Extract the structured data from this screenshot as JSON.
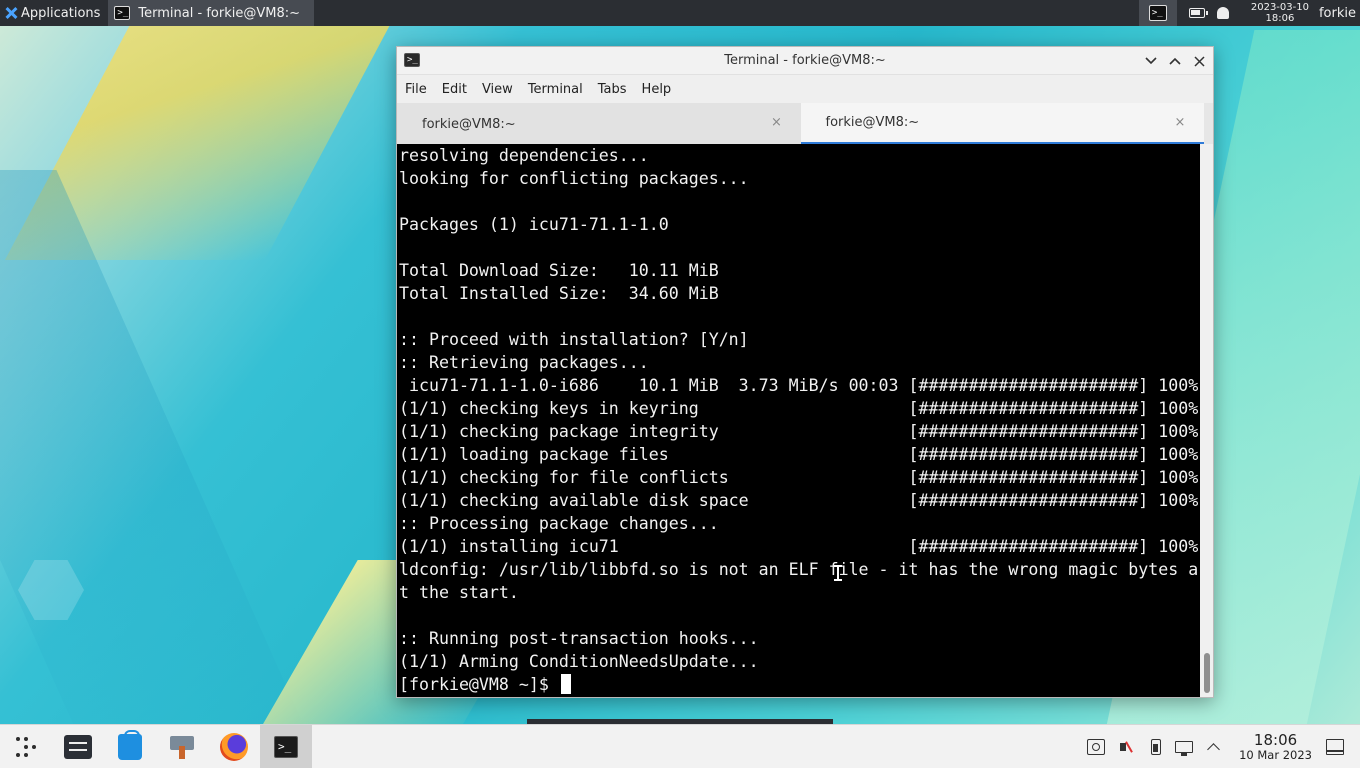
{
  "top_panel": {
    "applications_label": "Applications",
    "task_title": "Terminal - forkie@VM8:~",
    "date": "2023-03-10",
    "time": "18:06",
    "user": "forkie"
  },
  "window": {
    "title": "Terminal - forkie@VM8:~",
    "menu": [
      "File",
      "Edit",
      "View",
      "Terminal",
      "Tabs",
      "Help"
    ],
    "tabs": [
      {
        "label": "forkie@VM8:~",
        "active": false
      },
      {
        "label": "forkie@VM8:~",
        "active": true
      }
    ]
  },
  "terminal": {
    "lines": [
      "resolving dependencies...",
      "looking for conflicting packages...",
      "",
      "Packages (1) icu71-71.1-1.0",
      "",
      "Total Download Size:   10.11 MiB",
      "Total Installed Size:  34.60 MiB",
      "",
      ":: Proceed with installation? [Y/n]",
      ":: Retrieving packages...",
      " icu71-71.1-1.0-i686    10.1 MiB  3.73 MiB/s 00:03 [######################] 100%",
      "(1/1) checking keys in keyring                     [######################] 100%",
      "(1/1) checking package integrity                   [######################] 100%",
      "(1/1) loading package files                        [######################] 100%",
      "(1/1) checking for file conflicts                  [######################] 100%",
      "(1/1) checking available disk space                [######################] 100%",
      ":: Processing package changes...",
      "(1/1) installing icu71                             [######################] 100%",
      "ldconfig: /usr/lib/libbfd.so is not an ELF file - it has the wrong magic bytes a",
      "t the start.",
      "",
      ":: Running post-transaction hooks...",
      "(1/1) Arming ConditionNeedsUpdate...",
      "[forkie@VM8 ~]$ "
    ]
  },
  "taskbar": {
    "launchers": [
      {
        "name": "application-launcher-icon",
        "active": false
      },
      {
        "name": "file-manager-icon",
        "active": false
      },
      {
        "name": "software-store-icon",
        "active": false
      },
      {
        "name": "package-manager-icon",
        "active": false
      },
      {
        "name": "firefox-icon",
        "active": false
      },
      {
        "name": "terminal-icon",
        "active": true
      }
    ],
    "clock_time": "18:06",
    "clock_date": "10 Mar 2023"
  },
  "colors": {
    "accent": "#2f7bd8",
    "terminal_bg": "#000000",
    "terminal_fg": "#f2f2f2",
    "top_panel_bg": "#2b2e33"
  }
}
